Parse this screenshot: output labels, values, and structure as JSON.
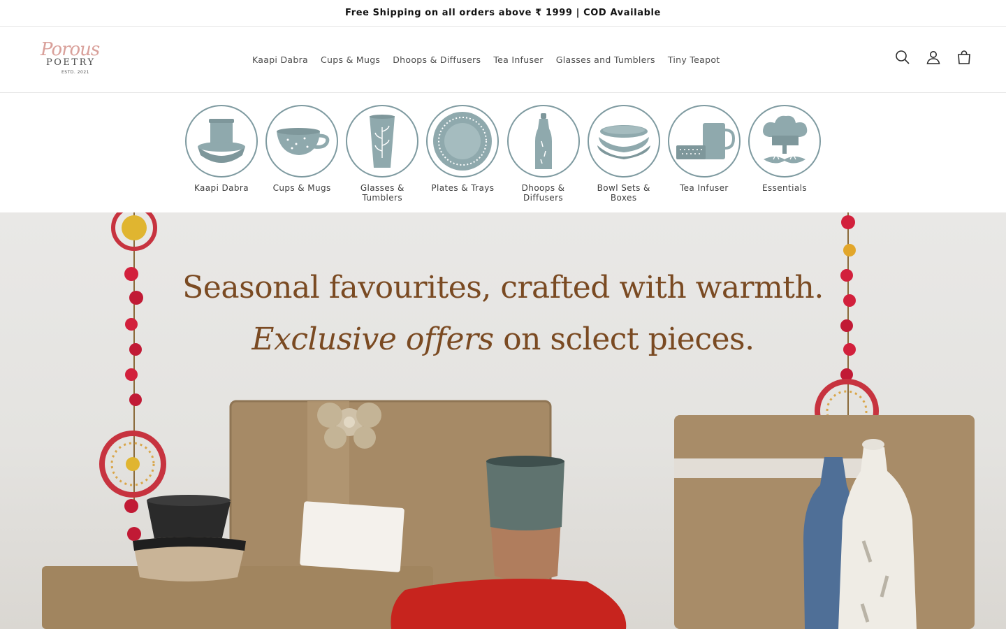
{
  "announcement": {
    "text": "Free Shipping on all orders above ₹ 1999 | COD Available"
  },
  "header": {
    "logo": {
      "script": "Porous",
      "word": "POETRY",
      "estd": "ESTD. 2021"
    },
    "nav": [
      {
        "label": "Kaapi Dabra"
      },
      {
        "label": "Cups & Mugs"
      },
      {
        "label": "Dhoops & Diffusers"
      },
      {
        "label": "Tea Infuser"
      },
      {
        "label": "Glasses and Tumblers"
      },
      {
        "label": "Tiny Teapot"
      }
    ],
    "icons": [
      "search-icon",
      "account-icon",
      "cart-icon"
    ]
  },
  "categories": [
    {
      "label": "Kaapi Dabra",
      "icon": "dabra-icon"
    },
    {
      "label": "Cups & Mugs",
      "icon": "cup-icon"
    },
    {
      "label": "Glasses & Tumblers",
      "icon": "tumbler-icon"
    },
    {
      "label": "Plates & Trays",
      "icon": "plate-icon"
    },
    {
      "label": "Dhoops & Diffusers",
      "icon": "diffuser-icon"
    },
    {
      "label": "Bowl Sets & Boxes",
      "icon": "bowls-icon"
    },
    {
      "label": "Tea Infuser",
      "icon": "infuser-icon"
    },
    {
      "label": "Essentials",
      "icon": "chef-hat-icon"
    }
  ],
  "hero": {
    "line1": "Seasonal favourites, crafted with warmth.",
    "line2_emphasis": "Exclusive offers",
    "line2_rest": " on sclect pieces."
  },
  "colors": {
    "icon_fill": "#8fa9ad",
    "icon_border": "#7e9aa0",
    "hero_text": "#7a4a22",
    "logo_script": "#d9a09a"
  }
}
